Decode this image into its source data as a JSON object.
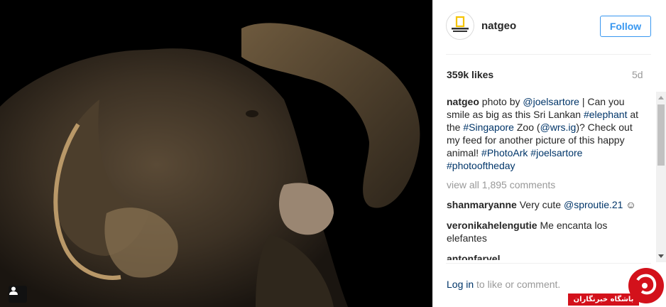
{
  "post": {
    "username": "natgeo",
    "follow_label": "Follow",
    "likes": "359k likes",
    "age": "5d",
    "caption": {
      "user": "natgeo",
      "parts": [
        {
          "text": " photo by ",
          "type": "text"
        },
        {
          "text": "@joelsartore",
          "type": "link"
        },
        {
          "text": " | Can you smile as big as this Sri Lankan ",
          "type": "text"
        },
        {
          "text": "#elephant",
          "type": "link"
        },
        {
          "text": " at the ",
          "type": "text"
        },
        {
          "text": "#Singapore",
          "type": "link"
        },
        {
          "text": " Zoo (",
          "type": "text"
        },
        {
          "text": "@wrs.ig",
          "type": "link"
        },
        {
          "text": ")? Check out my feed for another picture of this happy animal! ",
          "type": "text"
        },
        {
          "text": "#PhotoArk",
          "type": "link"
        },
        {
          "text": " ",
          "type": "text"
        },
        {
          "text": "#joelsartore",
          "type": "link"
        },
        {
          "text": " ",
          "type": "text"
        },
        {
          "text": "#photooftheday",
          "type": "link"
        }
      ]
    },
    "view_all": "view all 1,895 comments",
    "comments": [
      {
        "user": "shanmaryanne",
        "text": "Very cute ",
        "link": "@sproutie.21",
        "suffix": " ☺"
      },
      {
        "user": "veronikahelengutie",
        "text": "Me encanta los elefantes",
        "link": "",
        "suffix": ""
      },
      {
        "user": "antonfarvel",
        "text": "",
        "link": "",
        "suffix": ""
      }
    ],
    "footer_login": "Log in",
    "footer_rest": " to like or comment."
  },
  "watermark": {
    "label": "باشگاه خبرنگاران",
    "color": "#d3111b"
  },
  "colors": {
    "link": "#003569",
    "follow": "#3897f0",
    "muted": "#999999"
  },
  "icons": {
    "avatar": "national-geographic-logo",
    "tag": "user-icon"
  }
}
